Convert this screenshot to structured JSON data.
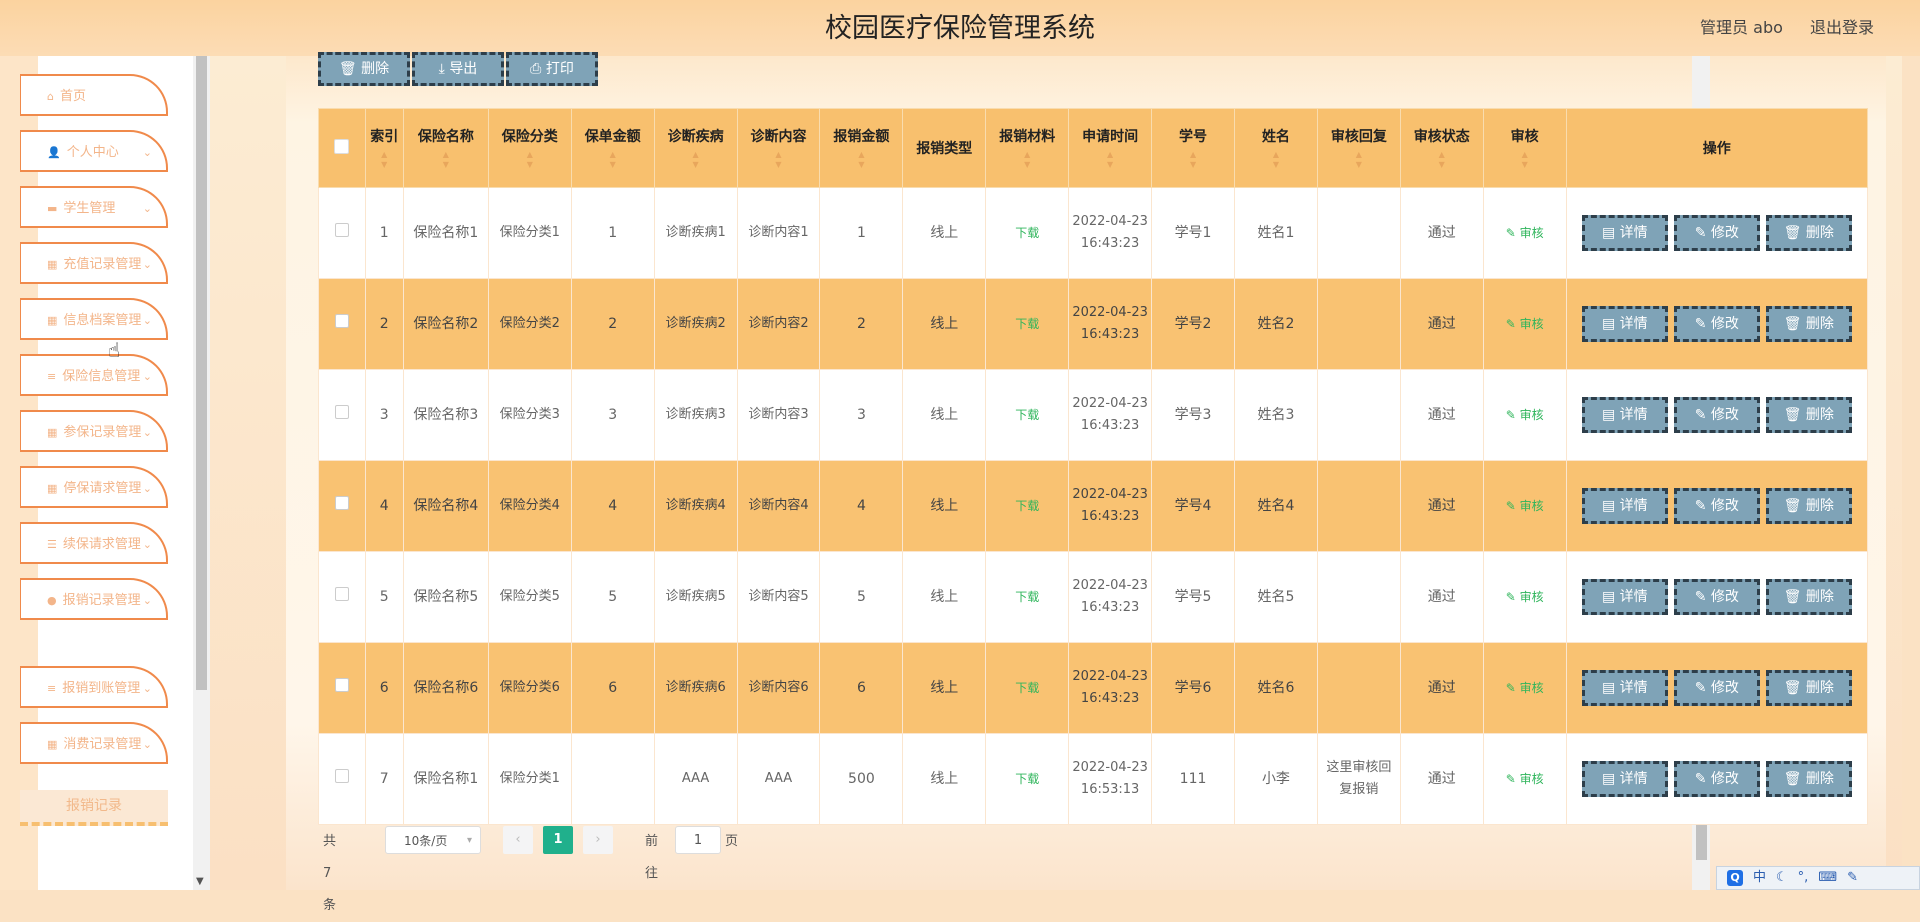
{
  "header": {
    "title": "校园医疗保险管理系统",
    "user_label": "管理员 abo",
    "logout": "退出登录"
  },
  "sidebar": {
    "items": [
      {
        "icon": "home-icon",
        "glyph": "⌂",
        "label": "首页",
        "chevron": false
      },
      {
        "icon": "person-icon",
        "glyph": "👤",
        "label": "个人中心",
        "chevron": true
      },
      {
        "icon": "monitor-icon",
        "glyph": "▬",
        "label": "学生管理",
        "chevron": true
      },
      {
        "icon": "grid-icon",
        "glyph": "▦",
        "label": "充值记录管理",
        "chevron": true
      },
      {
        "icon": "grid-icon",
        "glyph": "▦",
        "label": "信息档案管理",
        "chevron": true
      },
      {
        "icon": "list-icon",
        "glyph": "≡",
        "label": "保险信息管理",
        "chevron": true
      },
      {
        "icon": "grid-icon",
        "glyph": "▦",
        "label": "参保记录管理",
        "chevron": true
      },
      {
        "icon": "grid-icon",
        "glyph": "▦",
        "label": "停保请求管理",
        "chevron": true
      },
      {
        "icon": "sliders-icon",
        "glyph": "☰",
        "label": "续保请求管理",
        "chevron": true
      },
      {
        "icon": "location-icon",
        "glyph": "●",
        "label": "报销记录管理",
        "chevron": true
      },
      {
        "icon": "list-icon",
        "glyph": "≡",
        "label": "报销到账管理",
        "chevron": true
      },
      {
        "icon": "grid-icon",
        "glyph": "▦",
        "label": "消费记录管理",
        "chevron": true
      }
    ],
    "submenu": "报销记录"
  },
  "toolbar": {
    "delete": "删除",
    "export": "导出",
    "print": "打印"
  },
  "table": {
    "columns": [
      "索引",
      "保险名称",
      "保险分类",
      "保单金额",
      "诊断疾病",
      "诊断内容",
      "报销金额",
      "报销类型",
      "报销材料",
      "申请时间",
      "学号",
      "姓名",
      "审核回复",
      "审核状态",
      "审核",
      "操作"
    ],
    "rows": [
      [
        "1",
        "保险名称1",
        "保险分类1",
        "1",
        "诊断疾病1",
        "诊断内容1",
        "1",
        "线上",
        "下载",
        "2022-04-23 16:43:23",
        "学号1",
        "姓名1",
        "",
        "通过",
        "审核"
      ],
      [
        "2",
        "保险名称2",
        "保险分类2",
        "2",
        "诊断疾病2",
        "诊断内容2",
        "2",
        "线上",
        "下载",
        "2022-04-23 16:43:23",
        "学号2",
        "姓名2",
        "",
        "通过",
        "审核"
      ],
      [
        "3",
        "保险名称3",
        "保险分类3",
        "3",
        "诊断疾病3",
        "诊断内容3",
        "3",
        "线上",
        "下载",
        "2022-04-23 16:43:23",
        "学号3",
        "姓名3",
        "",
        "通过",
        "审核"
      ],
      [
        "4",
        "保险名称4",
        "保险分类4",
        "4",
        "诊断疾病4",
        "诊断内容4",
        "4",
        "线上",
        "下载",
        "2022-04-23 16:43:23",
        "学号4",
        "姓名4",
        "",
        "通过",
        "审核"
      ],
      [
        "5",
        "保险名称5",
        "保险分类5",
        "5",
        "诊断疾病5",
        "诊断内容5",
        "5",
        "线上",
        "下载",
        "2022-04-23 16:43:23",
        "学号5",
        "姓名5",
        "",
        "通过",
        "审核"
      ],
      [
        "6",
        "保险名称6",
        "保险分类6",
        "6",
        "诊断疾病6",
        "诊断内容6",
        "6",
        "线上",
        "下载",
        "2022-04-23 16:43:23",
        "学号6",
        "姓名6",
        "",
        "通过",
        "审核"
      ],
      [
        "7",
        "保险名称1",
        "保险分类1",
        "",
        "AAA",
        "AAA",
        "500",
        "线上",
        "下载",
        "2022-04-23 16:53:13",
        "111",
        "小李",
        "这里审核回复报销",
        "通过",
        "审核"
      ]
    ],
    "actions": {
      "detail": "详情",
      "edit": "修改",
      "delete": "删除"
    }
  },
  "pagination": {
    "total": "共 7 条",
    "page_size": "10条/页",
    "current": "1",
    "goto": "前往",
    "goto_value": "1",
    "page_unit": "页"
  },
  "ime": {
    "lang": "中"
  },
  "colors": {
    "header": "#fbd39f",
    "table_header": "#f8c06e",
    "even_row": "#f9c272",
    "button": "#7fa3b7",
    "menu_border": "#f08a4b",
    "pager_active": "#20b08c",
    "link": "#2fb55b"
  }
}
